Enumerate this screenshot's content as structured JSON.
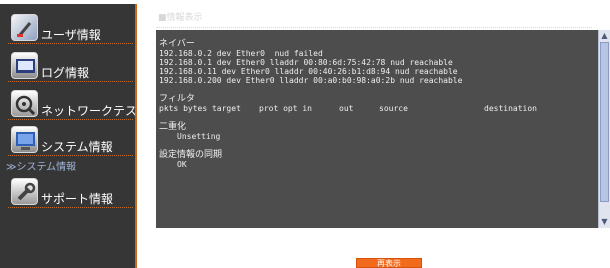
{
  "sidebar": {
    "items": [
      {
        "label": "ユーザ情報",
        "icon": "user-icon"
      },
      {
        "label": "ログ情報",
        "icon": "log-icon"
      },
      {
        "label": "ネットワークテスト",
        "icon": "network-test-icon"
      },
      {
        "label": "システム情報",
        "icon": "system-icon"
      },
      {
        "label": "サポート情報",
        "icon": "support-icon"
      }
    ],
    "sub_item": "≫システム情報"
  },
  "main": {
    "title": "■情報表示",
    "neighbor": {
      "title": "ネイバー",
      "lines": [
        "192.168.0.2 dev Ether0  nud failed",
        "192.168.0.1 dev Ether0 lladdr 00:80:6d:75:42:78 nud reachable",
        "192.168.0.11 dev Ether0 lladdr 00:40:26:b1:d8:94 nud reachable",
        "192.168.0.200 dev Ether0 lladdr 00:a0:b0:98:a0:2b nud reachable"
      ]
    },
    "filter": {
      "title": "フィルタ",
      "headers": [
        "pkts bytes target",
        "prot opt in",
        "out",
        "source",
        "destination"
      ]
    },
    "duplex": {
      "title": "二重化",
      "value": "Unsetting"
    },
    "sync": {
      "title": "設定情報の同期",
      "value": "OK"
    }
  },
  "refresh_button": "再表示",
  "colors": {
    "accent": "#c96a1a",
    "button": "#f26a1b",
    "sidebar_bg": "#363636",
    "panel_bg": "#4d4d4d"
  }
}
